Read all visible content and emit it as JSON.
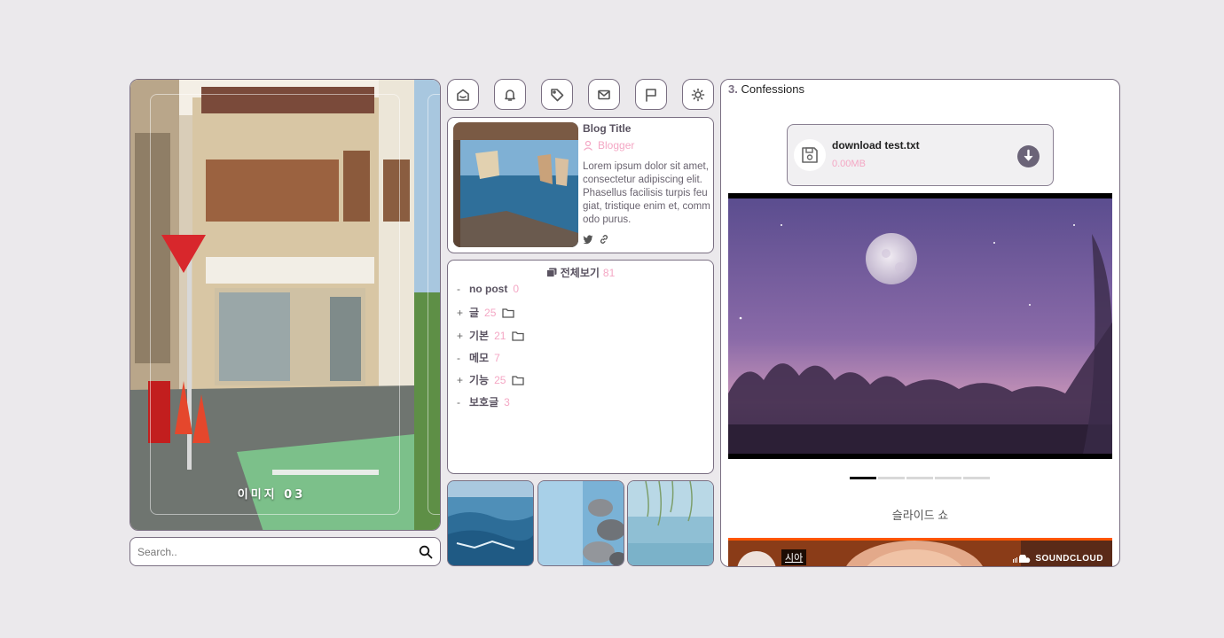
{
  "photo": {
    "caption": "이미지 03"
  },
  "search": {
    "placeholder": "Search.."
  },
  "icons": [
    "home-icon",
    "bell-icon",
    "tag-icon",
    "mail-icon",
    "flag-icon",
    "sun-icon"
  ],
  "profile": {
    "title": "Blog Title",
    "author": "Blogger",
    "description": "Lorem ipsum dolor sit amet, consectetur adipiscing elit. Phasellus facilisis turpis feugiat, tristique enim et, commodo purus."
  },
  "category": {
    "all_label": "전체보기",
    "all_count": "81",
    "items": [
      {
        "prefix": "-",
        "name": "no post",
        "count": "0"
      },
      {
        "prefix": "+",
        "name": "글",
        "count": "25"
      },
      {
        "prefix": "+",
        "name": "기본",
        "count": "21"
      },
      {
        "prefix": "-",
        "name": "메모",
        "count": "7"
      },
      {
        "prefix": "+",
        "name": "기능",
        "count": "25"
      },
      {
        "prefix": "-",
        "name": "보호글",
        "count": "3"
      }
    ]
  },
  "post": {
    "number": "3.",
    "title": "Confessions",
    "file_name": "download test.txt",
    "file_size": "0.00MB",
    "slide_caption": "슬라이드 쇼",
    "soundcloud_artist": "시아",
    "soundcloud_brand": "SOUNDCLOUD"
  },
  "colors": {
    "accent": "#7a6f82",
    "pink": "#f4a7c4",
    "background": "#ebe9ec"
  }
}
